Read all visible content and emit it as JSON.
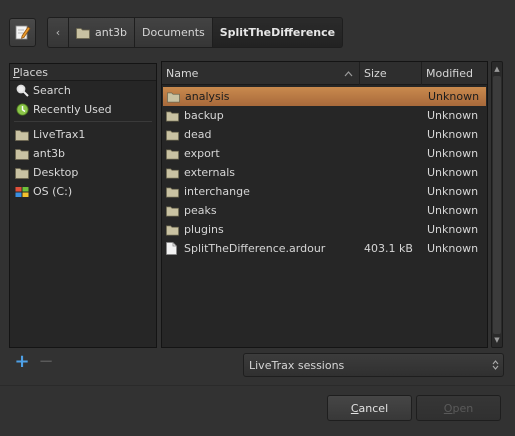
{
  "pathbar": {
    "back_arrow": "‹",
    "crumbs": [
      "ant3b",
      "Documents",
      "SplitTheDifference"
    ]
  },
  "places": {
    "header_prefix": "P",
    "header_rest": "laces",
    "items": [
      {
        "label": "Search",
        "icon": "search-icon"
      },
      {
        "label": "Recently Used",
        "icon": "recent-icon"
      },
      {
        "label": "LiveTrax1",
        "icon": "folder-icon"
      },
      {
        "label": "ant3b",
        "icon": "folder-icon"
      },
      {
        "label": "Desktop",
        "icon": "folder-icon"
      },
      {
        "label": "OS (C:)",
        "icon": "drive-icon"
      }
    ]
  },
  "files": {
    "columns": {
      "name": "Name",
      "size": "Size",
      "modified": "Modified"
    },
    "rows": [
      {
        "name": "analysis",
        "size": "",
        "modified": "Unknown",
        "type": "folder",
        "selected": true
      },
      {
        "name": "backup",
        "size": "",
        "modified": "Unknown",
        "type": "folder"
      },
      {
        "name": "dead",
        "size": "",
        "modified": "Unknown",
        "type": "folder"
      },
      {
        "name": "export",
        "size": "",
        "modified": "Unknown",
        "type": "folder"
      },
      {
        "name": "externals",
        "size": "",
        "modified": "Unknown",
        "type": "folder"
      },
      {
        "name": "interchange",
        "size": "",
        "modified": "Unknown",
        "type": "folder"
      },
      {
        "name": "peaks",
        "size": "",
        "modified": "Unknown",
        "type": "folder"
      },
      {
        "name": "plugins",
        "size": "",
        "modified": "Unknown",
        "type": "folder"
      },
      {
        "name": "SplitTheDifference.ardour",
        "size": "403.1 kB",
        "modified": "Unknown",
        "type": "file"
      }
    ]
  },
  "controls": {
    "add_label": "+",
    "remove_label": "−",
    "filter_value": "LiveTrax sessions",
    "cancel_mnemonic": "C",
    "cancel_rest": "ancel",
    "open_mnemonic": "O",
    "open_rest": "pen"
  },
  "colors": {
    "accent_selected": "#c98a4e",
    "add_icon": "#4ea0e6"
  }
}
